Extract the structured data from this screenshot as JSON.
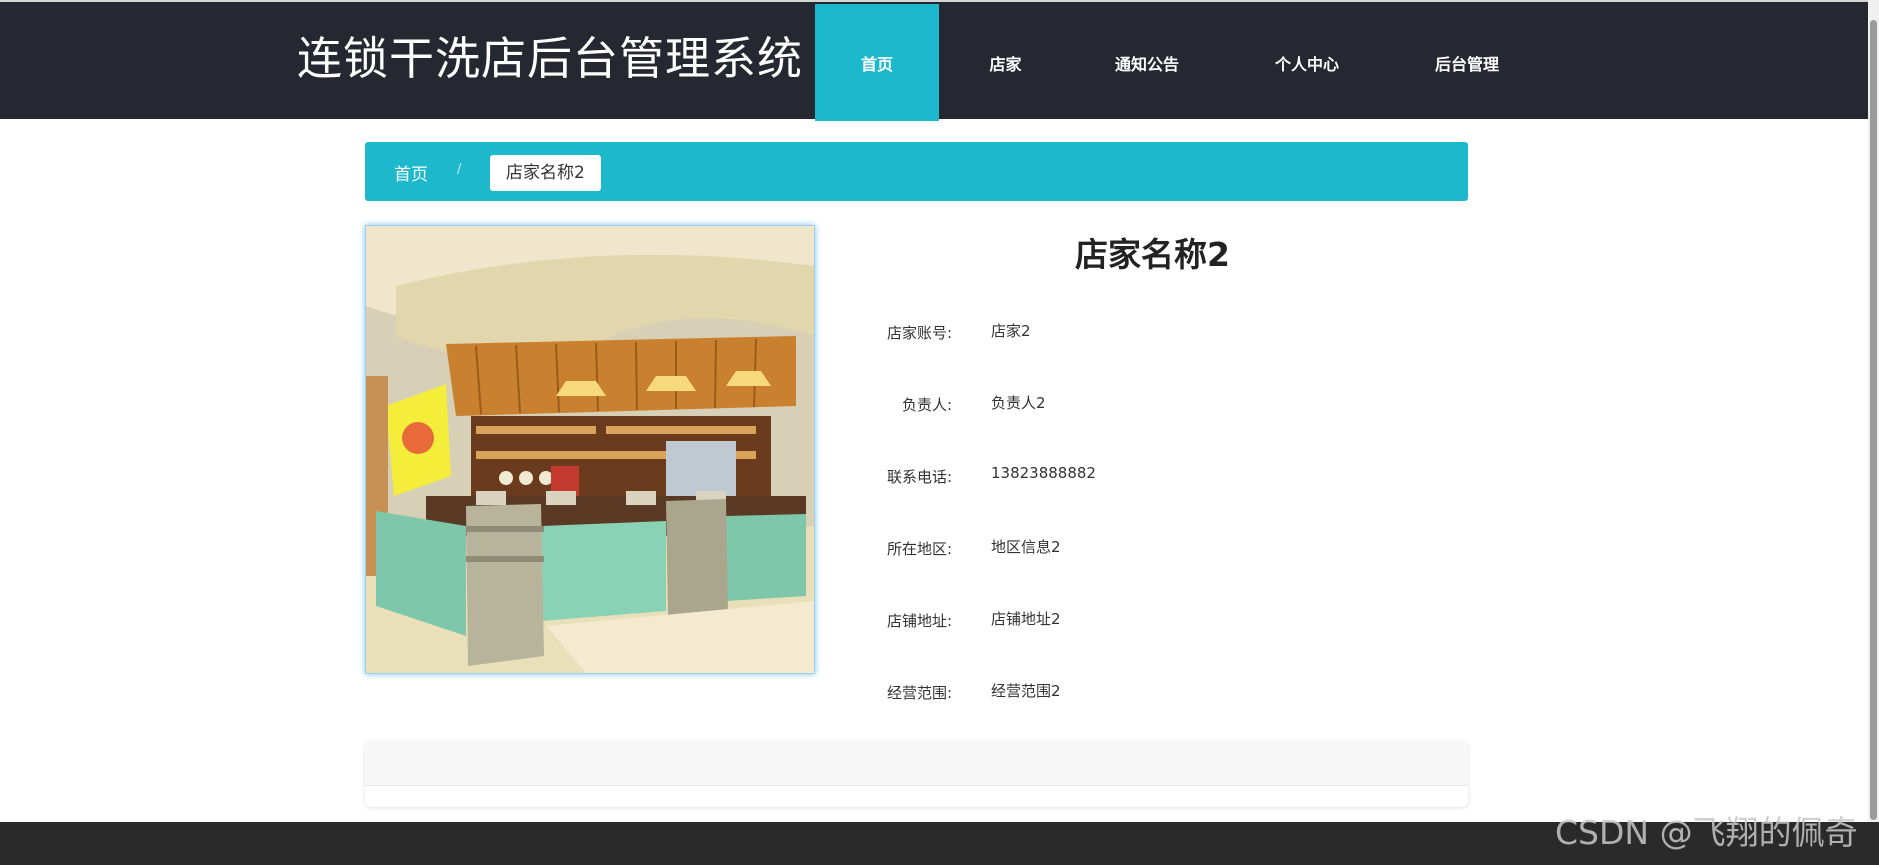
{
  "header": {
    "site_title": "连锁干洗店后台管理系统",
    "nav": [
      {
        "label": "首页",
        "active": true
      },
      {
        "label": "店家",
        "active": false
      },
      {
        "label": "通知公告",
        "active": false
      },
      {
        "label": "个人中心",
        "active": false
      },
      {
        "label": "后台管理",
        "active": false
      }
    ]
  },
  "breadcrumb": {
    "home": "首页",
    "separator": "/",
    "current": "店家名称2"
  },
  "store": {
    "name": "店家名称2",
    "image_alt": "store-interior-photo",
    "fields": [
      {
        "label": "店家账号:",
        "value": "店家2"
      },
      {
        "label": "负责人:",
        "value": "负责人2"
      },
      {
        "label": "联系电话:",
        "value": "13823888882"
      },
      {
        "label": "所在地区:",
        "value": "地区信息2"
      },
      {
        "label": "店铺地址:",
        "value": "店铺地址2"
      },
      {
        "label": "经营范围:",
        "value": "经营范围2"
      }
    ]
  },
  "watermark": "CSDN @飞翔的佩奇",
  "colors": {
    "header_bg": "#252831",
    "accent": "#1db8cb",
    "footer_bg": "#2a2a2a"
  }
}
